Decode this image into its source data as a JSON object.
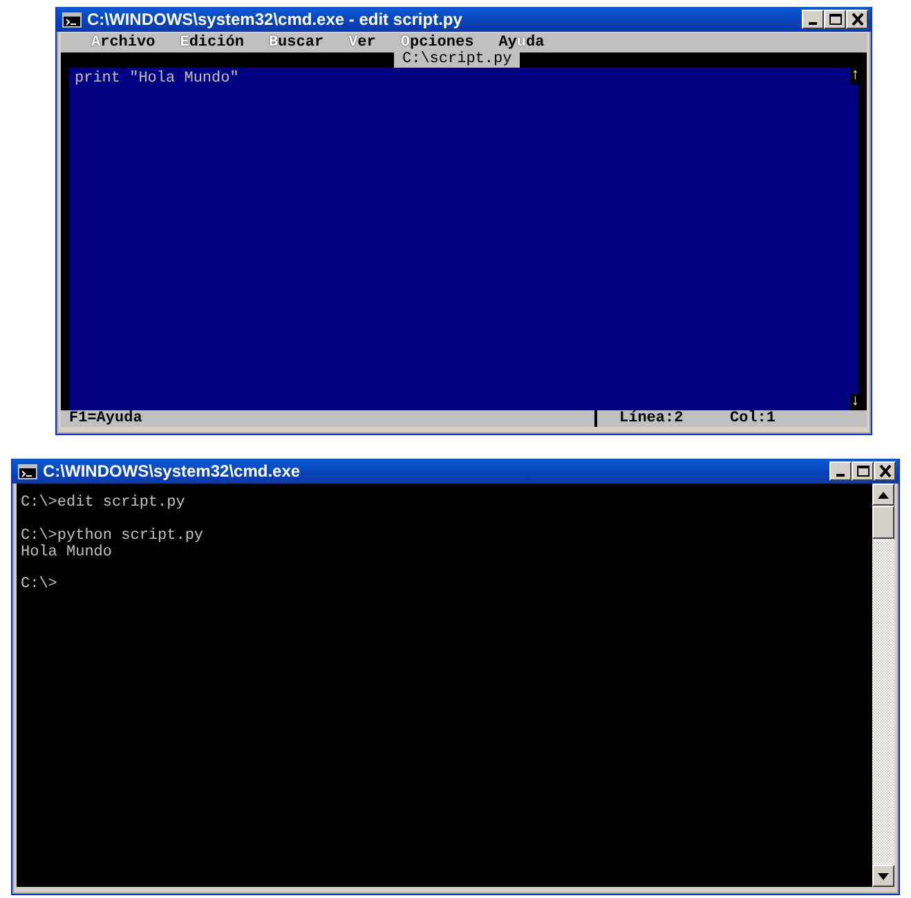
{
  "editor_window": {
    "title": "C:\\WINDOWS\\system32\\cmd.exe - edit script.py",
    "menu": [
      {
        "key": "A",
        "after": "rchivo"
      },
      {
        "key": "E",
        "after": "dición"
      },
      {
        "key": "B",
        "after": "uscar"
      },
      {
        "key": "V",
        "after": "er"
      },
      {
        "key": "O",
        "after": "pciones"
      },
      {
        "before": "Ay",
        "key": "u",
        "after": "da"
      }
    ],
    "document_title": "C:\\script.py",
    "lines": [
      "print \"Hola Mundo\""
    ],
    "scroll_up": "↑",
    "scroll_down": "↓",
    "status": {
      "help": "F1=Ayuda",
      "line": "Línea:2",
      "column": "Col:1"
    }
  },
  "console_window": {
    "title": "C:\\WINDOWS\\system32\\cmd.exe",
    "blocks": [
      [
        "C:\\>edit script.py"
      ],
      [
        "C:\\>python script.py",
        "Hola Mundo"
      ],
      [
        "C:\\>"
      ]
    ]
  }
}
